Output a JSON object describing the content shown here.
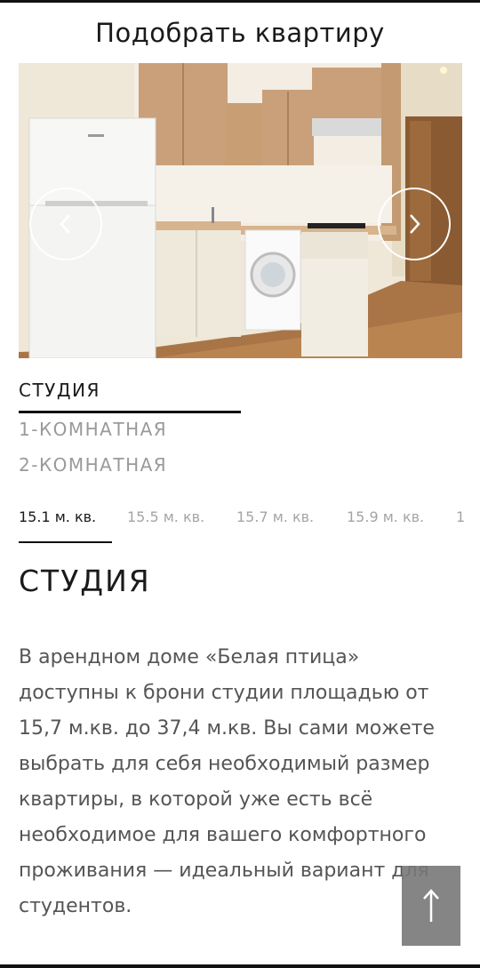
{
  "header": {
    "title": "Подобрать квартиру"
  },
  "gallery": {
    "prev_icon": "chevron-left-icon",
    "next_icon": "chevron-right-icon"
  },
  "apartment_types": [
    {
      "label": "СТУДИЯ",
      "active": true
    },
    {
      "label": "1-КОМНАТНАЯ",
      "active": false
    },
    {
      "label": "2-КОМНАТНАЯ",
      "active": false
    }
  ],
  "area_tabs": [
    {
      "label": "15.1 м. кв.",
      "active": true
    },
    {
      "label": "15.5 м. кв.",
      "active": false
    },
    {
      "label": "15.7 м. кв.",
      "active": false
    },
    {
      "label": "15.9 м. кв.",
      "active": false
    },
    {
      "label": "1",
      "active": false
    }
  ],
  "section": {
    "title": "СТУДИЯ",
    "description": "В арендном доме «Белая птица» доступны к брони студии площадью от 15,7 м.кв. до 37,4 м.кв. Вы сами можете выбрать для себя необходимый размер квартиры, в которой уже есть всё необходимое для вашего комфортного проживания — идеальный вариант для студентов."
  },
  "scroll_top": {
    "icon": "arrow-up-icon",
    "label": "↑"
  },
  "colors": {
    "accent": "#111111",
    "muted": "#9a9a9a",
    "text": "#555555"
  }
}
